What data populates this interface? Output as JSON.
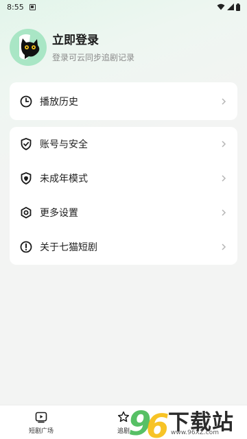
{
  "status_bar": {
    "time": "8:55"
  },
  "profile": {
    "title": "立即登录",
    "subtitle": "登录可云同步追剧记录"
  },
  "menu_top": [
    {
      "label": "播放历史",
      "icon": "clock-icon"
    }
  ],
  "menu_main": [
    {
      "label": "账号与安全",
      "icon": "shield-icon"
    },
    {
      "label": "未成年模式",
      "icon": "youth-shield-icon"
    },
    {
      "label": "更多设置",
      "icon": "settings-icon"
    },
    {
      "label": "关于七猫短剧",
      "icon": "info-icon"
    }
  ],
  "bottom_nav": [
    {
      "label": "短剧广场",
      "icon": "play-square-icon"
    },
    {
      "label": "追剧",
      "icon": "star-icon"
    }
  ],
  "watermark": {
    "brand": "下载站",
    "digits": "96",
    "url": "www.96XZ.com"
  },
  "colors": {
    "accent_green": "#a9e6c5",
    "watermark_green": "#39b54a",
    "watermark_yellow": "#f6b800"
  }
}
